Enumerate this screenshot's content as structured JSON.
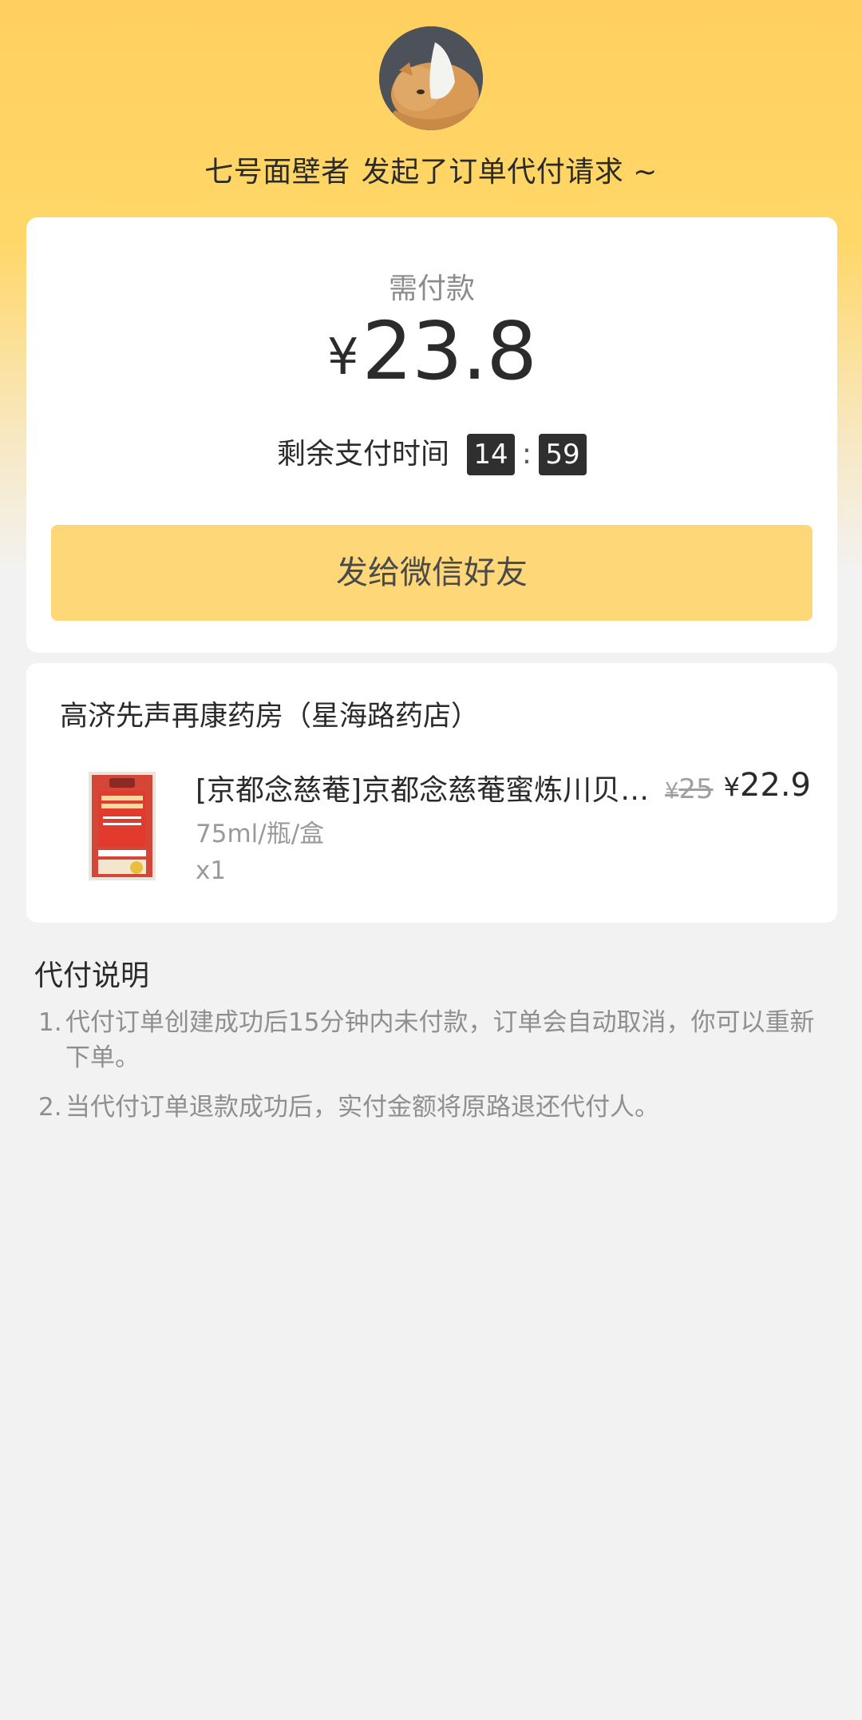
{
  "header": {
    "nickname": "七号面壁者",
    "request_text": "发起了订单代付请求 ~"
  },
  "payment": {
    "label": "需付款",
    "currency_symbol": "¥",
    "amount": "23.8",
    "countdown_label": "剩余支付时间",
    "minutes": "14",
    "separator": ":",
    "seconds": "59",
    "share_button": "发给微信好友"
  },
  "store": {
    "name": "高济先声再康药房（星海路药店）",
    "product": {
      "title": "[京都念慈菴]京都念慈菴蜜炼川贝枇杷膏",
      "spec": "75ml/瓶/盒",
      "quantity": "x1",
      "original_price_symbol": "¥",
      "original_price": "25",
      "price_symbol": "¥",
      "price": "22.9"
    }
  },
  "notes": {
    "title": "代付说明",
    "items": [
      {
        "index": "1.",
        "text": "代付订单创建成功后15分钟内未付款，订单会自动取消，你可以重新下单。"
      },
      {
        "index": "2.",
        "text": "当代付订单退款成功后，实付金额将原路退还代付人。"
      }
    ]
  },
  "colors": {
    "header_yellow": "#ffd060",
    "button_yellow": "#fdd778",
    "page_bg": "#f2f2f2",
    "timer_box": "#2f2f2f"
  },
  "icons": {
    "avatar": "cat-avatar",
    "product_image": "medicine-box-image"
  }
}
